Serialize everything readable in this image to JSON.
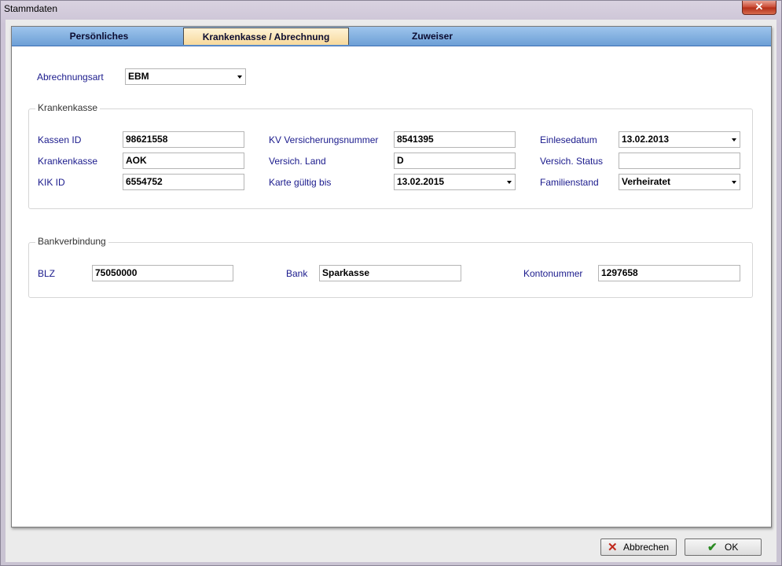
{
  "window": {
    "title": "Stammdaten",
    "close_glyph": "✕"
  },
  "tabs": [
    {
      "label": "Persönliches",
      "active": false
    },
    {
      "label": "Krankenkasse / Abrechnung",
      "active": true
    },
    {
      "label": "Zuweiser",
      "active": false
    }
  ],
  "abrechnung": {
    "label": "Abrechnungsart",
    "value": "EBM"
  },
  "krankenkasse": {
    "legend": "Krankenkasse",
    "kassen_id": {
      "label": "Kassen ID",
      "value": "98621558"
    },
    "krankenkasse": {
      "label": "Krankenkasse",
      "value": "AOK"
    },
    "kik_id": {
      "label": "KIK ID",
      "value": "6554752"
    },
    "kv_nummer": {
      "label": "KV Versicherungsnummer",
      "value": "8541395"
    },
    "versich_land": {
      "label": "Versich. Land",
      "value": "D"
    },
    "karte_gueltig": {
      "label": "Karte gültig bis",
      "value": "13.02.2015"
    },
    "einlesedatum": {
      "label": "Einlesedatum",
      "value": "13.02.2013"
    },
    "versich_status": {
      "label": "Versich. Status",
      "value": ""
    },
    "familienstand": {
      "label": "Familienstand",
      "value": "Verheiratet"
    }
  },
  "bank": {
    "legend": "Bankverbindung",
    "blz": {
      "label": "BLZ",
      "value": "75050000"
    },
    "bank": {
      "label": "Bank",
      "value": "Sparkasse"
    },
    "konto": {
      "label": "Kontonummer",
      "value": "1297658"
    }
  },
  "buttons": {
    "cancel": {
      "label": "Abbrechen",
      "icon": "x-icon"
    },
    "ok": {
      "label": "OK",
      "icon": "checkmark-icon"
    }
  },
  "colors": {
    "label_blue": "#1a1a8c",
    "active_tab": "#f7d99c",
    "tabbar": "#6d9fd6"
  }
}
